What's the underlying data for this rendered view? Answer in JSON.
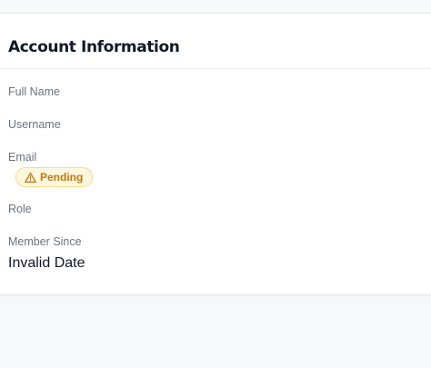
{
  "section": {
    "title": "Account Information"
  },
  "fields": {
    "full_name": {
      "label": "Full Name",
      "value": ""
    },
    "username": {
      "label": "Username",
      "value": ""
    },
    "email": {
      "label": "Email",
      "value": "",
      "status": "Pending",
      "status_icon": "warning-triangle-icon"
    },
    "role": {
      "label": "Role",
      "value": ""
    },
    "member_since": {
      "label": "Member Since",
      "value": "Invalid Date"
    }
  },
  "colors": {
    "page_bg": "#f7f8fa",
    "card_bg": "#ffffff",
    "title": "#111827",
    "label": "#6b7280",
    "badge_bg": "#fef7e0",
    "badge_border": "#fcd98a",
    "badge_text": "#c2780a"
  }
}
